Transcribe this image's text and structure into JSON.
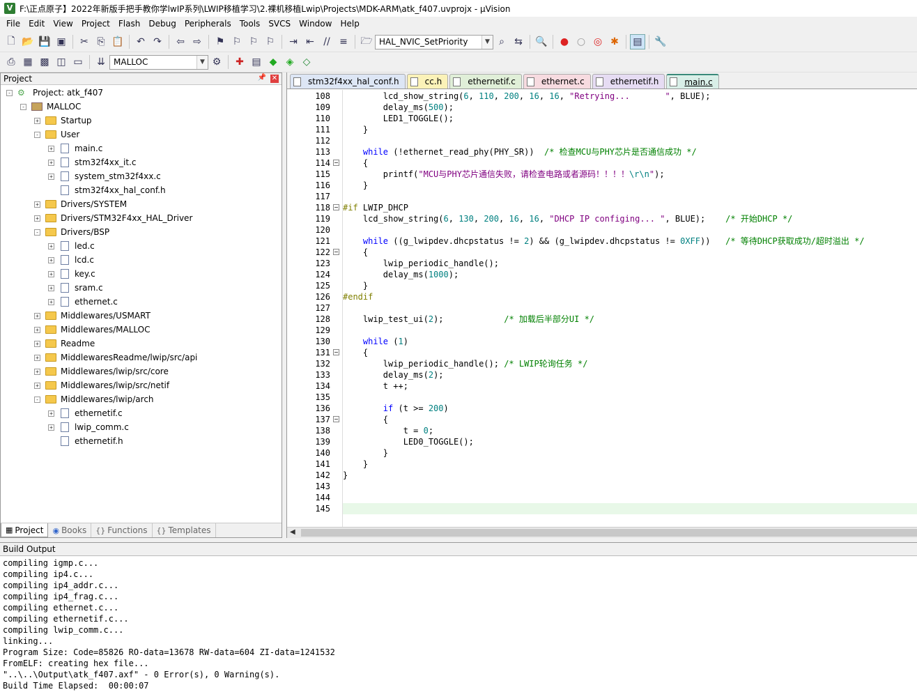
{
  "window": {
    "title": "F:\\正点原子】2022年新版手把手教你学lwIP系列\\LWIP移植学习\\2.裸机移植Lwip\\Projects\\MDK-ARM\\atk_f407.uvprojx - µVision"
  },
  "menu": [
    "File",
    "Edit",
    "View",
    "Project",
    "Flash",
    "Debug",
    "Peripherals",
    "Tools",
    "SVCS",
    "Window",
    "Help"
  ],
  "toolbar": {
    "function_combo": "HAL_NVIC_SetPriority",
    "target_combo": "MALLOC"
  },
  "project_panel": {
    "title": "Project",
    "root": "Project: atk_f407",
    "target": "MALLOC",
    "tree": [
      {
        "label": "Startup",
        "type": "folder",
        "level": 2,
        "exp": "+"
      },
      {
        "label": "User",
        "type": "folder",
        "level": 2,
        "exp": "-"
      },
      {
        "label": "main.c",
        "type": "file",
        "level": 3,
        "exp": "+"
      },
      {
        "label": "stm32f4xx_it.c",
        "type": "file",
        "level": 3,
        "exp": "+"
      },
      {
        "label": "system_stm32f4xx.c",
        "type": "file",
        "level": 3,
        "exp": "+"
      },
      {
        "label": "stm32f4xx_hal_conf.h",
        "type": "file",
        "level": 3,
        "exp": ""
      },
      {
        "label": "Drivers/SYSTEM",
        "type": "folder",
        "level": 2,
        "exp": "+"
      },
      {
        "label": "Drivers/STM32F4xx_HAL_Driver",
        "type": "folder",
        "level": 2,
        "exp": "+"
      },
      {
        "label": "Drivers/BSP",
        "type": "folder",
        "level": 2,
        "exp": "-"
      },
      {
        "label": "led.c",
        "type": "file",
        "level": 3,
        "exp": "+"
      },
      {
        "label": "lcd.c",
        "type": "file",
        "level": 3,
        "exp": "+"
      },
      {
        "label": "key.c",
        "type": "file",
        "level": 3,
        "exp": "+"
      },
      {
        "label": "sram.c",
        "type": "file",
        "level": 3,
        "exp": "+"
      },
      {
        "label": "ethernet.c",
        "type": "file",
        "level": 3,
        "exp": "+"
      },
      {
        "label": "Middlewares/USMART",
        "type": "folder",
        "level": 2,
        "exp": "+"
      },
      {
        "label": "Middlewares/MALLOC",
        "type": "folder",
        "level": 2,
        "exp": "+"
      },
      {
        "label": "Readme",
        "type": "folder",
        "level": 2,
        "exp": "+"
      },
      {
        "label": "MiddlewaresReadme/lwip/src/api",
        "type": "folder",
        "level": 2,
        "exp": "+"
      },
      {
        "label": "Middlewares/lwip/src/core",
        "type": "folder",
        "level": 2,
        "exp": "+"
      },
      {
        "label": "Middlewares/lwip/src/netif",
        "type": "folder",
        "level": 2,
        "exp": "+"
      },
      {
        "label": "Middlewares/lwip/arch",
        "type": "folder",
        "level": 2,
        "exp": "-"
      },
      {
        "label": "ethernetif.c",
        "type": "file",
        "level": 3,
        "exp": "+"
      },
      {
        "label": "lwip_comm.c",
        "type": "file",
        "level": 3,
        "exp": "+"
      },
      {
        "label": "ethernetif.h",
        "type": "file",
        "level": 3,
        "exp": ""
      }
    ],
    "tabs": [
      "Project",
      "Books",
      "Functions",
      "Templates"
    ]
  },
  "editor_tabs": [
    {
      "label": "stm32f4xx_hal_conf.h",
      "color": "#dde6f5"
    },
    {
      "label": "cc.h",
      "color": "#fbf2b8"
    },
    {
      "label": "ethernetif.c",
      "color": "#e0efd8"
    },
    {
      "label": "ethernet.c",
      "color": "#f7dbe0"
    },
    {
      "label": "ethernetif.h",
      "color": "#e6dcf3"
    },
    {
      "label": "main.c",
      "color": "#d9efe8",
      "active": true
    }
  ],
  "code": {
    "line_numbers": [
      "108",
      "109",
      "110",
      "111",
      "112",
      "113",
      "114",
      "115",
      "116",
      "117",
      "118",
      "119",
      "120",
      "121",
      "122",
      "123",
      "124",
      "125",
      "126",
      "127",
      "128",
      "129",
      "130",
      "131",
      "132",
      "133",
      "134",
      "135",
      "136",
      "137",
      "138",
      "139",
      "140",
      "141",
      "142",
      "143",
      "144",
      "145"
    ],
    "fold_lines": [
      114,
      118,
      122,
      131,
      137
    ],
    "lines": [
      [
        [
          "        lcd_show_string(",
          ""
        ],
        [
          "6",
          "num"
        ],
        [
          ", ",
          ""
        ],
        [
          "110",
          "num"
        ],
        [
          ", ",
          ""
        ],
        [
          "200",
          "num"
        ],
        [
          ", ",
          ""
        ],
        [
          "16",
          "num"
        ],
        [
          ", ",
          ""
        ],
        [
          "16",
          "num"
        ],
        [
          ", ",
          ""
        ],
        [
          "\"Retrying...       \"",
          "str"
        ],
        [
          ", BLUE);",
          ""
        ]
      ],
      [
        [
          "        delay_ms(",
          ""
        ],
        [
          "500",
          "num"
        ],
        [
          ");",
          ""
        ]
      ],
      [
        [
          "        LED1_TOGGLE();",
          ""
        ]
      ],
      [
        [
          "    }",
          ""
        ]
      ],
      [
        [
          "",
          ""
        ]
      ],
      [
        [
          "    ",
          ""
        ],
        [
          "while",
          "kw"
        ],
        [
          " (!ethernet_read_phy(PHY_SR))  ",
          ""
        ],
        [
          "/* 检查MCU与PHY芯片是否通信成功 */",
          "cm"
        ]
      ],
      [
        [
          "    {",
          ""
        ]
      ],
      [
        [
          "        printf(",
          ""
        ],
        [
          "\"MCU与PHY芯片通信失败，请检查电路或者源码！！！！",
          "str"
        ],
        [
          "\\r\\n",
          "num"
        ],
        [
          "\"",
          "str"
        ],
        [
          ");",
          ""
        ]
      ],
      [
        [
          "    }",
          ""
        ]
      ],
      [
        [
          "",
          ""
        ]
      ],
      [
        [
          "#if",
          "pp"
        ],
        [
          " LWIP_DHCP",
          ""
        ]
      ],
      [
        [
          "    lcd_show_string(",
          ""
        ],
        [
          "6",
          "num"
        ],
        [
          ", ",
          ""
        ],
        [
          "130",
          "num"
        ],
        [
          ", ",
          ""
        ],
        [
          "200",
          "num"
        ],
        [
          ", ",
          ""
        ],
        [
          "16",
          "num"
        ],
        [
          ", ",
          ""
        ],
        [
          "16",
          "num"
        ],
        [
          ", ",
          ""
        ],
        [
          "\"DHCP IP configing... \"",
          "str"
        ],
        [
          ", BLUE);    ",
          ""
        ],
        [
          "/* 开始DHCP */",
          "cm"
        ]
      ],
      [
        [
          "",
          ""
        ]
      ],
      [
        [
          "    ",
          ""
        ],
        [
          "while",
          "kw"
        ],
        [
          " ((g_lwipdev.dhcpstatus != ",
          ""
        ],
        [
          "2",
          "num"
        ],
        [
          ") && (g_lwipdev.dhcpstatus != ",
          ""
        ],
        [
          "0XFF",
          "num"
        ],
        [
          "))   ",
          ""
        ],
        [
          "/* 等待DHCP获取成功/超时溢出 */",
          "cm"
        ]
      ],
      [
        [
          "    {",
          ""
        ]
      ],
      [
        [
          "        lwip_periodic_handle();",
          ""
        ]
      ],
      [
        [
          "        delay_ms(",
          ""
        ],
        [
          "1000",
          "num"
        ],
        [
          ");",
          ""
        ]
      ],
      [
        [
          "    }",
          ""
        ]
      ],
      [
        [
          "#endif",
          "pp"
        ]
      ],
      [
        [
          "",
          ""
        ]
      ],
      [
        [
          "    lwip_test_ui(",
          ""
        ],
        [
          "2",
          "num"
        ],
        [
          ");            ",
          ""
        ],
        [
          "/* 加载后半部分UI */",
          "cm"
        ]
      ],
      [
        [
          "",
          ""
        ]
      ],
      [
        [
          "    ",
          ""
        ],
        [
          "while",
          "kw"
        ],
        [
          " (",
          ""
        ],
        [
          "1",
          "num"
        ],
        [
          ")",
          ""
        ]
      ],
      [
        [
          "    {",
          ""
        ]
      ],
      [
        [
          "        lwip_periodic_handle(); ",
          ""
        ],
        [
          "/* LWIP轮询任务 */",
          "cm"
        ]
      ],
      [
        [
          "        delay_ms(",
          ""
        ],
        [
          "2",
          "num"
        ],
        [
          ");",
          ""
        ]
      ],
      [
        [
          "        t ++;",
          ""
        ]
      ],
      [
        [
          "",
          ""
        ]
      ],
      [
        [
          "        ",
          ""
        ],
        [
          "if",
          "kw"
        ],
        [
          " (t >= ",
          ""
        ],
        [
          "200",
          "num"
        ],
        [
          ")",
          ""
        ]
      ],
      [
        [
          "        {",
          ""
        ]
      ],
      [
        [
          "            t = ",
          ""
        ],
        [
          "0",
          "num"
        ],
        [
          ";",
          ""
        ]
      ],
      [
        [
          "            LED0_TOGGLE();",
          ""
        ]
      ],
      [
        [
          "        }",
          ""
        ]
      ],
      [
        [
          "    }",
          ""
        ]
      ],
      [
        [
          "}",
          ""
        ]
      ],
      [
        [
          "",
          ""
        ]
      ],
      [
        [
          "",
          ""
        ]
      ],
      [
        [
          "",
          ""
        ]
      ]
    ]
  },
  "build_output": {
    "title": "Build Output",
    "lines": [
      "compiling igmp.c...",
      "compiling ip4.c...",
      "compiling ip4_addr.c...",
      "compiling ip4_frag.c...",
      "compiling ethernet.c...",
      "compiling ethernetif.c...",
      "compiling lwip_comm.c...",
      "linking...",
      "Program Size: Code=85826 RO-data=13678 RW-data=604 ZI-data=1241532",
      "FromELF: creating hex file...",
      "\"..\\..\\Output\\atk_f407.axf\" - 0 Error(s), 0 Warning(s).",
      "Build Time Elapsed:  00:00:07"
    ]
  }
}
